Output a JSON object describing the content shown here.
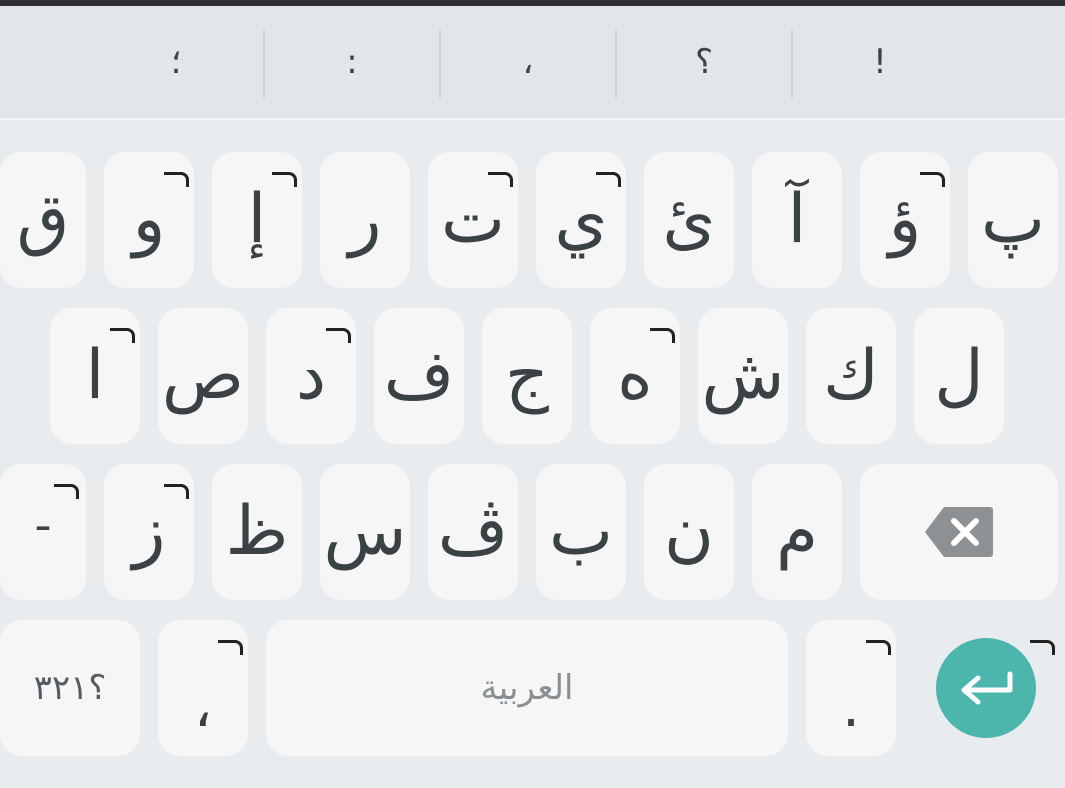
{
  "suggestions": [
    "؛",
    ":",
    "،",
    "؟",
    "!"
  ],
  "rows": {
    "row1": [
      "ق",
      "و",
      "إ",
      "ر",
      "ت",
      "ي",
      "ئ",
      "آ",
      "ؤ",
      "پ"
    ],
    "row2": [
      "ا",
      "ص",
      "د",
      "ف",
      "ج",
      "ه",
      "ش",
      "ك",
      "ل"
    ],
    "row3": [
      "ـ",
      "ز",
      "ظ",
      "س",
      "ڤ",
      "ب",
      "ن",
      "م"
    ]
  },
  "bottom": {
    "symbols_label": "؟٣٢١",
    "comma": "،",
    "space_label": "العربية",
    "period": "."
  },
  "colors": {
    "accent": "#4cb5ac",
    "key_bg": "#f6f6f6",
    "keyboard_bg": "#e9ecef",
    "key_text": "#3a4246"
  },
  "icons": {
    "backspace": "backspace-icon",
    "enter": "enter-arrow-icon"
  }
}
